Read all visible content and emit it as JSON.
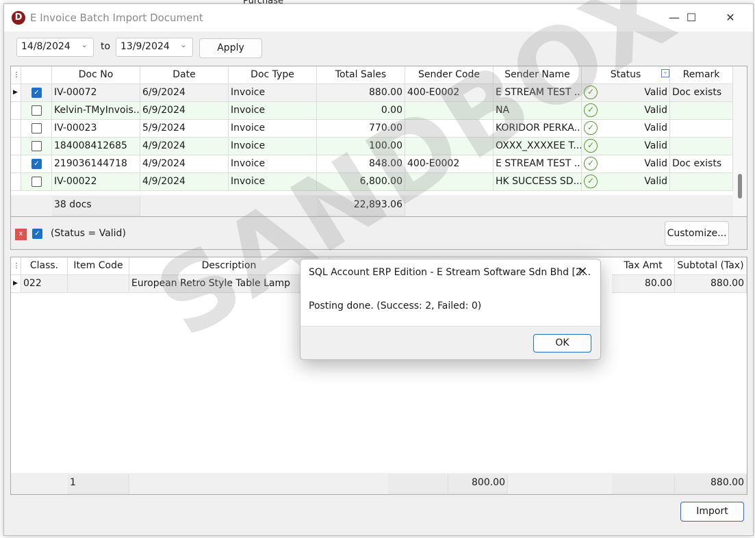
{
  "background": {
    "text": "Purchase"
  },
  "window": {
    "title": "E Invoice Batch Import Document",
    "logo_letter": "D",
    "minimize_icon": "minimize-icon",
    "maximize_icon": "maximize-icon",
    "close_icon": "close-icon"
  },
  "toolbar": {
    "from_date": "14/8/2024",
    "to_label": "to",
    "to_date": "13/9/2024",
    "apply_label": "Apply"
  },
  "doc_grid": {
    "columns": [
      "Doc No",
      "Date",
      "Doc Type",
      "Total Sales",
      "Sender Code",
      "Sender Name",
      "Status",
      "Remark"
    ],
    "rows": [
      {
        "checked": true,
        "doc_no": "IV-00072",
        "date": "6/9/2024",
        "doc_type": "Invoice",
        "total_sales": "880.00",
        "sender_code": "400-E0002",
        "sender_name": "E STREAM TEST ...",
        "status": "Valid",
        "remark": "Doc exists"
      },
      {
        "checked": false,
        "doc_no": "Kelvin-TMyInvois...",
        "date": "6/9/2024",
        "doc_type": "Invoice",
        "total_sales": "0.00",
        "sender_code": "",
        "sender_name": "NA",
        "status": "Valid",
        "remark": ""
      },
      {
        "checked": false,
        "doc_no": "IV-00023",
        "date": "5/9/2024",
        "doc_type": "Invoice",
        "total_sales": "770.00",
        "sender_code": "",
        "sender_name": "KORIDOR PERKA...",
        "status": "Valid",
        "remark": ""
      },
      {
        "checked": false,
        "doc_no": "184008412685",
        "date": "4/9/2024",
        "doc_type": "Invoice",
        "total_sales": "100.00",
        "sender_code": "",
        "sender_name": "OXXX_XXXXEE T...",
        "status": "Valid",
        "remark": ""
      },
      {
        "checked": true,
        "doc_no": "219036144718",
        "date": "4/9/2024",
        "doc_type": "Invoice",
        "total_sales": "848.00",
        "sender_code": "400-E0002",
        "sender_name": "E STREAM TEST ...",
        "status": "Valid",
        "remark": "Doc exists"
      },
      {
        "checked": false,
        "doc_no": "IV-00022",
        "date": "4/9/2024",
        "doc_type": "Invoice",
        "total_sales": "6,800.00",
        "sender_code": "",
        "sender_name": "HK SUCCESS SD...",
        "status": "Valid",
        "remark": ""
      }
    ],
    "footer": {
      "count": "38 docs",
      "total_sales": "22,893.06"
    }
  },
  "filter": {
    "text": "(Status = Valid)",
    "remove_label": "x",
    "customize_label": "Customize..."
  },
  "detail_grid": {
    "columns": [
      "Class.",
      "Item Code",
      "Description",
      "Tax Amt",
      "Subtotal (Tax)"
    ],
    "rows": [
      {
        "class": "022",
        "item_code": "",
        "description": "European Retro Style Table Lamp",
        "tax_amt": "80.00",
        "subtotal": "880.00"
      }
    ],
    "footer": {
      "count": "1",
      "amount": "800.00",
      "subtotal": "880.00"
    }
  },
  "import_label": "Import",
  "watermark": "SANDBOX",
  "dialog": {
    "title": "SQL Account ERP Edition - E Stream Software Sdn Bhd [2...",
    "message": "Posting done. (Success: 2, Failed: 0)",
    "ok_label": "OK"
  },
  "colors": {
    "accent": "#1f6fc7",
    "valid": "#5a9a2e",
    "alt_row": "#eefbee"
  }
}
